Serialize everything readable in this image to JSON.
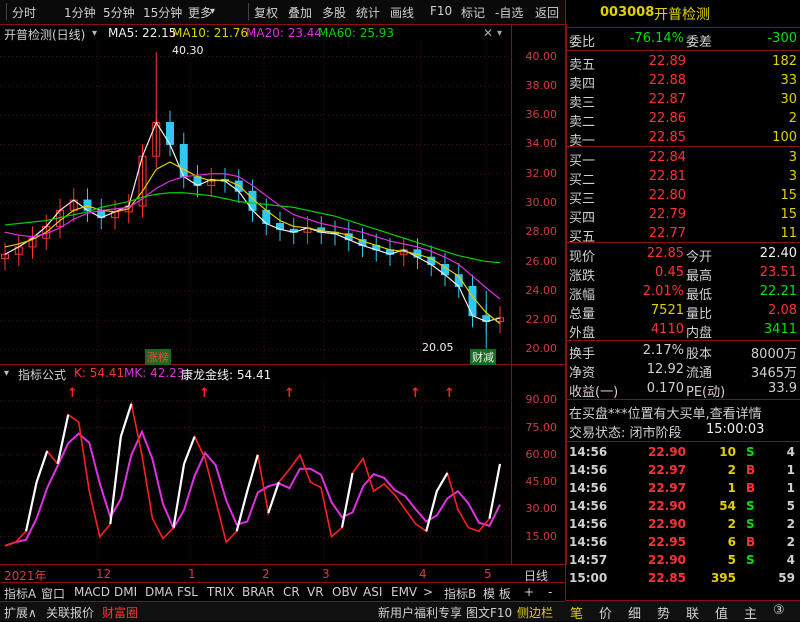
{
  "toolbar": {
    "items": [
      "分时",
      "1分钟",
      "5分钟",
      "15分钟",
      "更多",
      "复权",
      "叠加",
      "多股",
      "统计",
      "画线",
      "F10",
      "标记",
      "-自选",
      "返回"
    ]
  },
  "chart": {
    "stock_name": "开普检测(日线)",
    "ma5": "MA5: 22.15",
    "ma10": "MA10: 21.76",
    "ma20": "MA20: 23.44",
    "ma60": "MA60: 25.93",
    "high_label": "40.30",
    "low_label": "20.05",
    "badge_left": "涨榜",
    "badge_right": "财减",
    "price_axis": [
      "40.00",
      "38.00",
      "36.00",
      "34.00",
      "32.00",
      "30.00",
      "28.00",
      "26.00",
      "24.00",
      "22.00",
      "20.00"
    ],
    "indicator_title": "指标公式",
    "k_value": "K: 54.41",
    "mk_value": "MK: 42.23",
    "kl_value": "康龙金线: 54.41",
    "ind_axis": [
      "90.00",
      "75.00",
      "60.00",
      "45.00",
      "30.00",
      "15.00"
    ],
    "x_labels": [
      "2021年",
      "12",
      "1",
      "2",
      "3",
      "4",
      "5"
    ],
    "period": "日线",
    "colors": {
      "ma5": "#f0f0f0",
      "ma10": "#e0d000",
      "ma20": "#e030e0",
      "ma60": "#00d000",
      "up": "#ff3232",
      "down": "#30c8f0"
    }
  },
  "chart_data": {
    "type": "line",
    "title": "开普检测(日线)",
    "ylim": [
      19,
      41
    ],
    "series": [
      {
        "name": "MA5",
        "values": [
          26.5,
          27.0,
          27.6,
          28.4,
          29.5,
          30.2,
          29.5,
          29.0,
          29.4,
          29.8,
          33.2,
          35.5,
          34.0,
          31.8,
          31.2,
          31.6,
          31.5,
          30.8,
          29.5,
          28.6,
          28.2,
          28.0,
          28.3,
          28.0,
          27.9,
          27.5,
          27.1,
          26.8,
          26.5,
          26.8,
          26.3,
          25.8,
          25.1,
          24.3,
          22.3,
          21.9,
          22.15
        ]
      },
      {
        "name": "MA10",
        "values": [
          27.0,
          27.2,
          27.5,
          28.0,
          28.8,
          29.5,
          29.8,
          29.5,
          29.4,
          29.6,
          30.8,
          32.3,
          32.8,
          32.3,
          31.8,
          31.5,
          31.6,
          31.2,
          30.3,
          29.5,
          28.8,
          28.4,
          28.3,
          28.1,
          28.0,
          27.8,
          27.4,
          27.1,
          26.8,
          26.7,
          26.5,
          26.2,
          25.6,
          25.0,
          23.6,
          22.5,
          21.76
        ]
      },
      {
        "name": "MA20",
        "values": [
          28.0,
          27.8,
          27.7,
          27.9,
          28.3,
          28.9,
          29.3,
          29.5,
          29.6,
          29.7,
          30.3,
          31.0,
          31.5,
          31.8,
          31.9,
          32.0,
          32.0,
          31.8,
          31.2,
          30.5,
          29.8,
          29.2,
          28.9,
          28.6,
          28.4,
          28.2,
          28.0,
          27.7,
          27.4,
          27.2,
          27.0,
          26.7,
          26.3,
          25.8,
          25.0,
          24.2,
          23.44
        ]
      },
      {
        "name": "MA60",
        "values": [
          28.5,
          28.6,
          28.7,
          28.8,
          29.0,
          29.2,
          29.4,
          29.7,
          29.9,
          30.1,
          30.4,
          30.6,
          30.7,
          30.7,
          30.6,
          30.5,
          30.3,
          30.1,
          30.0,
          29.9,
          29.8,
          29.7,
          29.5,
          29.3,
          29.1,
          28.8,
          28.5,
          28.2,
          27.9,
          27.6,
          27.3,
          27.0,
          26.7,
          26.4,
          26.2,
          26.0,
          25.93
        ]
      }
    ]
  },
  "quote": {
    "code": "003008",
    "name": "开普检测",
    "webi_label": "委比",
    "webi_value": "-76.14%",
    "weicha_label": "委差",
    "weicha_value": "-300",
    "sell": [
      {
        "label": "卖五",
        "price": "22.89",
        "vol": "182"
      },
      {
        "label": "卖四",
        "price": "22.88",
        "vol": "33"
      },
      {
        "label": "卖三",
        "price": "22.87",
        "vol": "30"
      },
      {
        "label": "卖二",
        "price": "22.86",
        "vol": "2"
      },
      {
        "label": "卖一",
        "price": "22.85",
        "vol": "100"
      }
    ],
    "buy": [
      {
        "label": "买一",
        "price": "22.84",
        "vol": "3"
      },
      {
        "label": "买二",
        "price": "22.81",
        "vol": "3"
      },
      {
        "label": "买三",
        "price": "22.80",
        "vol": "15"
      },
      {
        "label": "买四",
        "price": "22.79",
        "vol": "15"
      },
      {
        "label": "买五",
        "price": "22.77",
        "vol": "11"
      }
    ],
    "stats": [
      {
        "l1": "现价",
        "v1": "22.85",
        "c1": "red",
        "l2": "今开",
        "v2": "22.40",
        "c2": "white"
      },
      {
        "l1": "涨跌",
        "v1": "0.45",
        "c1": "red",
        "l2": "最高",
        "v2": "23.51",
        "c2": "red"
      },
      {
        "l1": "涨幅",
        "v1": "2.01%",
        "c1": "red",
        "l2": "最低",
        "v2": "22.21",
        "c2": "green"
      },
      {
        "l1": "总量",
        "v1": "7521",
        "c1": "yellow",
        "l2": "量比",
        "v2": "2.08",
        "c2": "red"
      },
      {
        "l1": "外盘",
        "v1": "4110",
        "c1": "red",
        "l2": "内盘",
        "v2": "3411",
        "c2": "green"
      }
    ],
    "stats2": [
      {
        "l1": "换手",
        "v1": "2.17%",
        "l2": "股本",
        "v2": "8000万"
      },
      {
        "l1": "净资",
        "v1": "12.92",
        "l2": "流通",
        "v2": "3465万"
      },
      {
        "l1": "收益(一)",
        "v1": "0.170",
        "l2": "PE(动)",
        "v2": "33.9"
      }
    ],
    "notice": "在买盘***位置有大买单,查看详情",
    "trade_status_label": "交易状态: 闭市阶段",
    "trade_status_time": "15:00:03",
    "ticks": [
      {
        "t": "14:56",
        "p": "22.90",
        "v": "10",
        "d": "S",
        "n": "4"
      },
      {
        "t": "14:56",
        "p": "22.97",
        "v": "2",
        "d": "B",
        "n": "1"
      },
      {
        "t": "14:56",
        "p": "22.97",
        "v": "1",
        "d": "B",
        "n": "1"
      },
      {
        "t": "14:56",
        "p": "22.90",
        "v": "54",
        "d": "S",
        "n": "5"
      },
      {
        "t": "14:56",
        "p": "22.90",
        "v": "2",
        "d": "S",
        "n": "2"
      },
      {
        "t": "14:56",
        "p": "22.95",
        "v": "6",
        "d": "B",
        "n": "2"
      },
      {
        "t": "14:57",
        "p": "22.90",
        "v": "5",
        "d": "S",
        "n": "4"
      },
      {
        "t": "15:00",
        "p": "22.85",
        "v": "395",
        "d": "",
        "n": "59"
      }
    ]
  },
  "tabs": [
    "指标A",
    "窗口",
    "MACD",
    "DMI",
    "DMA",
    "FSL",
    "TRIX",
    "BRAR",
    "CR",
    "VR",
    "OBV",
    "ASI",
    "EMV",
    ">",
    "指标B",
    "模 板",
    "+",
    "-"
  ],
  "status": {
    "left": [
      "扩展∧",
      "关联报价",
      "财富圈"
    ],
    "right": [
      "新用户福利专享",
      "图文F10",
      "侧边栏"
    ]
  },
  "right_bottom": [
    "笔",
    "价",
    "细",
    "势",
    "联",
    "值",
    "主",
    "③"
  ]
}
